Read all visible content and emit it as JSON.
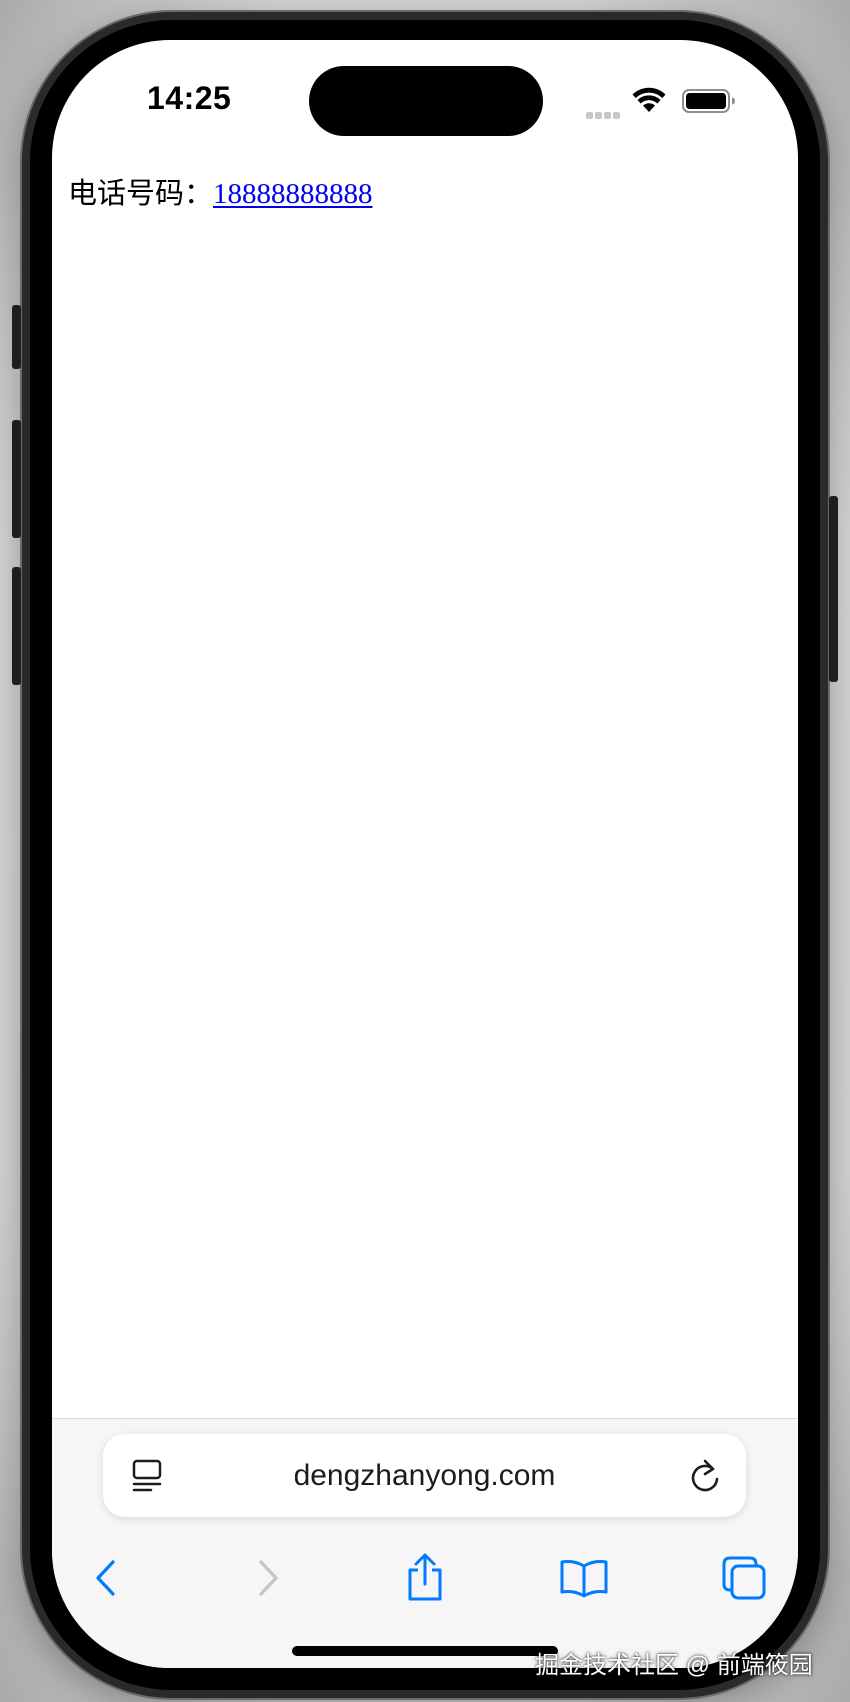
{
  "status_bar": {
    "time": "14:25",
    "icons": [
      "cellular-signal-icon",
      "wifi-icon",
      "battery-icon"
    ]
  },
  "page": {
    "phone_label": "电话号码：",
    "phone_number": "18888888888",
    "link_color": "#0000ee"
  },
  "browser": {
    "url": "dengzhanyong.com",
    "url_left_icon": "page-menu-icon",
    "url_right_icon": "reload-icon",
    "toolbar_icons": [
      "back-icon",
      "forward-icon",
      "share-icon",
      "bookmarks-icon",
      "tabs-icon"
    ],
    "accent_color": "#007aff",
    "disabled_color": "#c4c4c6"
  },
  "watermark": "掘金技术社区 @ 前端筱园"
}
